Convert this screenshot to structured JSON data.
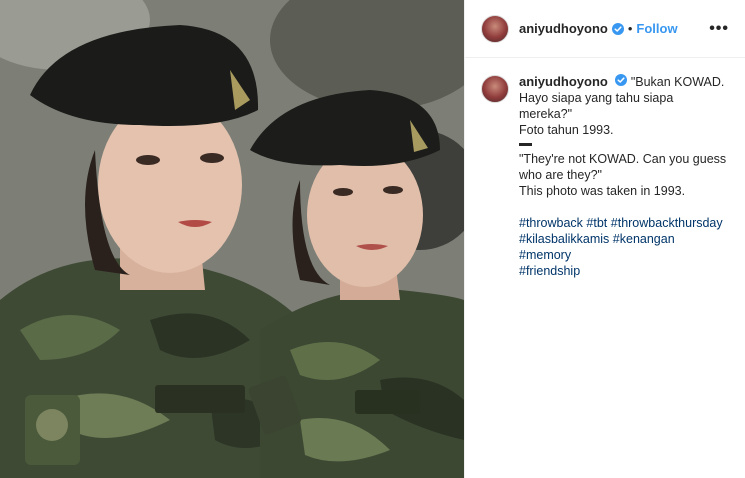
{
  "post": {
    "username": "aniyudhoyono",
    "follow_label": "Follow",
    "more_label": "•••",
    "separator": "•",
    "caption": {
      "line1": "\"Bukan KOWAD.",
      "line2": "Hayo siapa yang tahu siapa mereka?\"",
      "line3": "Foto tahun 1993.",
      "line4": "\"They're not KOWAD. Can you guess",
      "line5": "who are they?\"",
      "line6": "This photo was taken in 1993."
    },
    "hashtags": [
      "#throwback",
      "#tbt",
      "#throwbackthursday",
      "#kilasbalikkamis",
      "#kenangan",
      "#memory",
      "#friendship"
    ]
  },
  "colors": {
    "link": "#003569",
    "follow": "#3897f0",
    "verified": "#3897f0"
  }
}
